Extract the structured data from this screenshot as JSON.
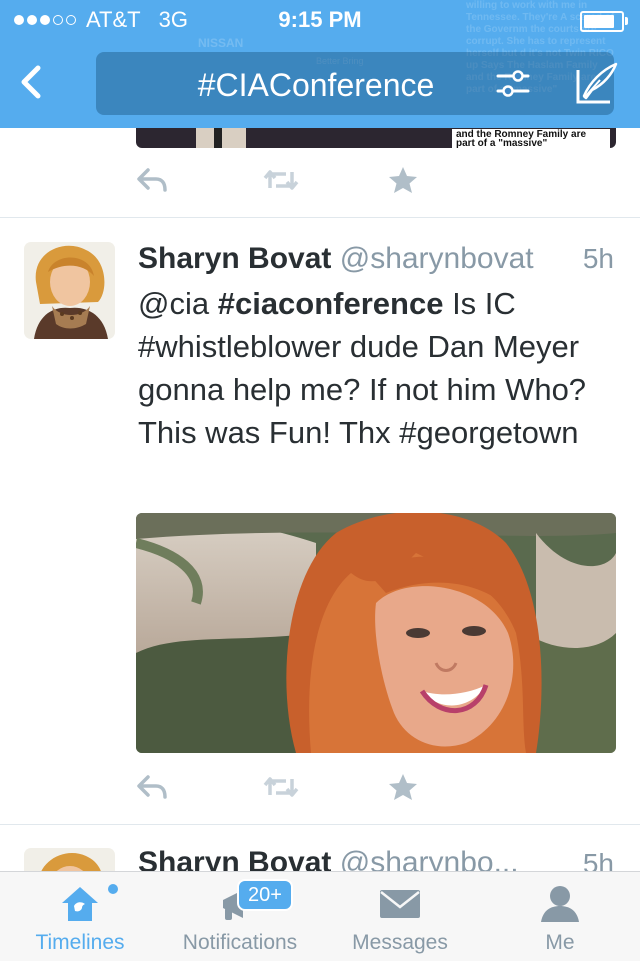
{
  "status_bar": {
    "carrier": "AT&T",
    "network": "3G",
    "time": "9:15 PM",
    "signal_bars": 3,
    "battery_level": 0.95
  },
  "header": {
    "back_icon": "chevron-left-icon",
    "search_query": "#CIAConference",
    "filter_icon": "sliders-icon",
    "compose_icon": "compose-tweet-icon",
    "background_image_text": "willing to work with me in Tennessee. They're A scared of the Governm the courts are corrupt. She has to represent herself but d it's not Twin RICO up Says The Haslam Family and the Romney Family are part of a \"massive\"",
    "background_brand_text": "NISSAN",
    "background_caption_text": "Better Bring"
  },
  "prev_tweet": {
    "image_caption": "and the Romney Family are part of a \"massive\""
  },
  "actions": {
    "reply_icon": "reply-icon",
    "retweet_icon": "retweet-icon",
    "favorite_icon": "star-icon"
  },
  "tweet": {
    "display_name": "Sharyn Bovat",
    "handle": "@sharynbovat",
    "time": "5h",
    "text_parts": {
      "p1": "@cia ",
      "p2": "#ciaconference",
      "p3": " Is IC #whistleblower dude Dan Meyer gonna help me? If not him Who? This was Fun! Thx #georgetown"
    }
  },
  "next_tweet": {
    "display_name": "Sharyn Bovat",
    "handle": "@sharynbo...",
    "time": "5h"
  },
  "tabbar": {
    "tabs": [
      {
        "label": "Timelines",
        "icon": "home-icon",
        "active": true
      },
      {
        "label": "Notifications",
        "icon": "megaphone-icon",
        "active": false
      },
      {
        "label": "Messages",
        "icon": "envelope-icon",
        "active": false
      },
      {
        "label": "Me",
        "icon": "person-icon",
        "active": false
      }
    ],
    "notifications_badge": "20+"
  },
  "colors": {
    "accent": "#55acee",
    "muted": "#8899a6",
    "text": "#292f33"
  }
}
